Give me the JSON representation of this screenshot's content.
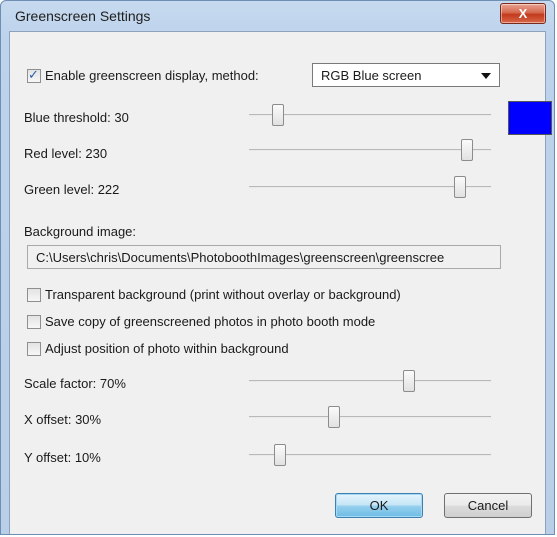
{
  "window": {
    "title": "Greenscreen Settings",
    "close_label": "X"
  },
  "enable": {
    "label": "Enable greenscreen display, method:",
    "checked": true,
    "method_value": "RGB Blue screen"
  },
  "sliders": {
    "blue_threshold": {
      "label": "Blue threshold: 30",
      "level": 0.12
    },
    "red_level": {
      "label": "Red level: 230",
      "level": 0.9
    },
    "green_level": {
      "label": "Green level: 222",
      "level": 0.87
    },
    "scale_factor": {
      "label": "Scale factor: 70%",
      "level": 0.66
    },
    "x_offset": {
      "label": "X offset: 30%",
      "level": 0.35
    },
    "y_offset": {
      "label": "Y offset: 10%",
      "level": 0.13
    }
  },
  "swatch_color": "#0000ff",
  "background_image": {
    "label": "Background image:",
    "path": "C:\\Users\\chris\\Documents\\PhotoboothImages\\greenscreen\\greenscree"
  },
  "options": {
    "transparent": {
      "label": "Transparent background (print without overlay or background)",
      "checked": false
    },
    "save_copy": {
      "label": "Save copy of greenscreened photos in photo booth mode",
      "checked": false
    },
    "adjust_position": {
      "label": "Adjust position of photo within background",
      "checked": false
    }
  },
  "buttons": {
    "ok": "OK",
    "cancel": "Cancel"
  }
}
